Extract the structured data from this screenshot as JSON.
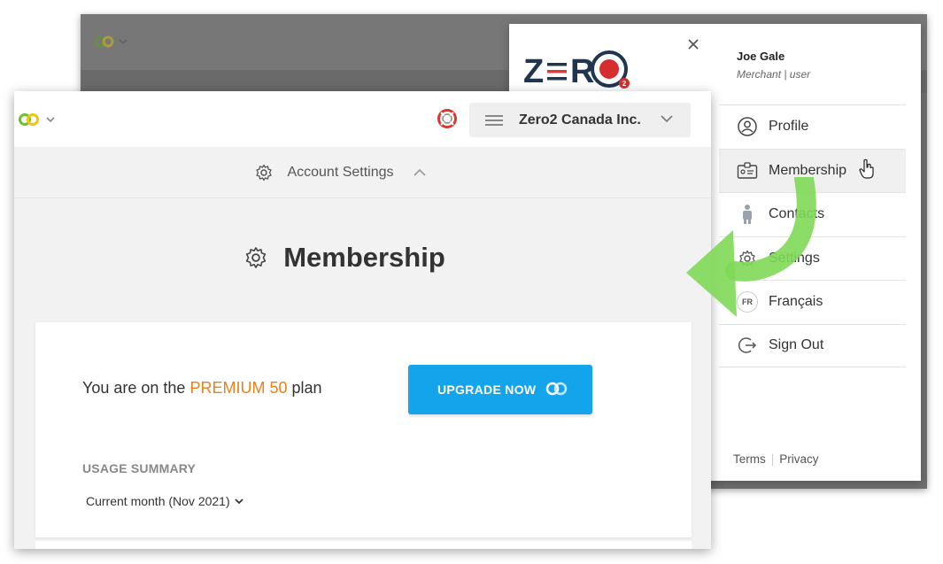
{
  "brand": {
    "app_logo": "zero2-rings-logo",
    "company_logo_text": "ZERO",
    "company_logo_badge": "2"
  },
  "user": {
    "name": "Joe Gale",
    "role": "Merchant | user"
  },
  "menu": {
    "items": [
      {
        "label": "Profile",
        "icon": "user-circle-icon"
      },
      {
        "label": "Membership",
        "icon": "id-card-icon"
      },
      {
        "label": "Contacts",
        "icon": "person-icon"
      },
      {
        "label": "Settings",
        "icon": "gear-icon"
      },
      {
        "label": "Français",
        "icon": "fr-badge",
        "badge": "FR"
      },
      {
        "label": "Sign Out",
        "icon": "sign-out-icon"
      }
    ],
    "footer": {
      "terms": "Terms",
      "separator": "|",
      "privacy": "Privacy"
    }
  },
  "header": {
    "company_name": "Zero2 Canada Inc."
  },
  "settings_bar": {
    "label": "Account Settings"
  },
  "main": {
    "title": "Membership",
    "plan_prefix": "You are on the ",
    "plan_name": "PREMIUM 50",
    "plan_suffix": " plan",
    "upgrade_label": "UPGRADE NOW",
    "usage_label": "USAGE SUMMARY",
    "period": "Current month (Nov 2021)"
  },
  "colors": {
    "accent_orange": "#e8811a",
    "button_blue": "#13a4ec",
    "arrow_green": "#7ed957"
  }
}
